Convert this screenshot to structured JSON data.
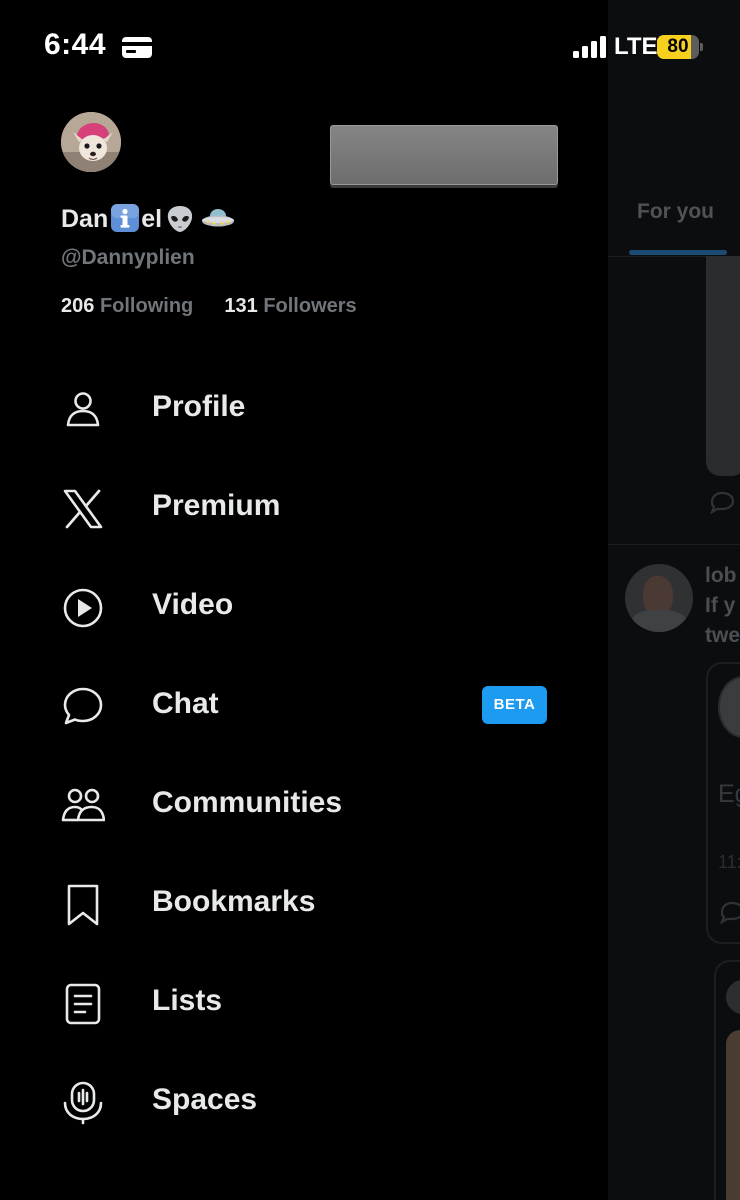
{
  "status_bar": {
    "time": "6:44",
    "network": "LTE",
    "battery_level": "80",
    "battery_fraction": 0.8,
    "icons": [
      "card-icon",
      "signal-icon",
      "battery-icon"
    ]
  },
  "profile": {
    "name_part1": "Dan",
    "name_part2": "el",
    "handle": "@Dannyplien",
    "following_count": "206",
    "following_label": "Following",
    "followers_count": "131",
    "followers_label": "Followers"
  },
  "menu": [
    {
      "label": "Profile",
      "icon": "person-icon"
    },
    {
      "label": "Premium",
      "icon": "x-logo-icon"
    },
    {
      "label": "Video",
      "icon": "play-circle-icon"
    },
    {
      "label": "Chat",
      "icon": "chat-bubble-icon",
      "badge": "BETA"
    },
    {
      "label": "Communities",
      "icon": "people-icon"
    },
    {
      "label": "Bookmarks",
      "icon": "bookmark-icon"
    },
    {
      "label": "Lists",
      "icon": "list-icon"
    },
    {
      "label": "Spaces",
      "icon": "microphone-icon"
    }
  ],
  "feed_background": {
    "tab_label": "For you",
    "post_author_fragment": "lob",
    "post_line1_fragment": "If y",
    "post_line2_fragment": "twe",
    "card_text_fragment": "Eg",
    "card_time_fragment": "11:"
  },
  "colors": {
    "background": "#000000",
    "text_primary": "#e7e9ea",
    "text_secondary": "#71767b",
    "accent": "#1d9bf0",
    "battery": "#f7cf1d"
  }
}
